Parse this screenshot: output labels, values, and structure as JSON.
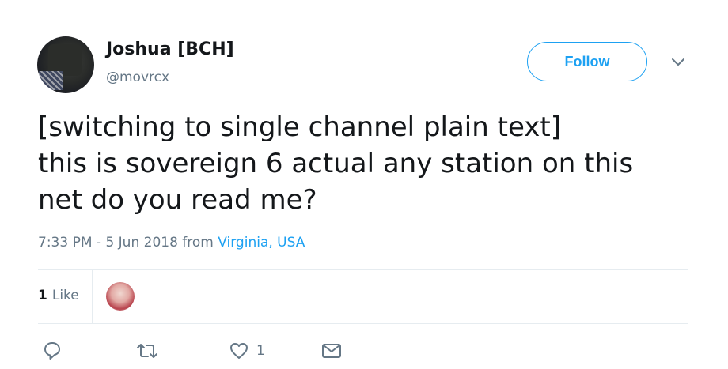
{
  "user": {
    "display_name": "Joshua [BCH]",
    "handle": "@movrcx"
  },
  "header": {
    "follow_label": "Follow"
  },
  "tweet": {
    "lines": [
      "[switching to single channel plain text]",
      "this is sovereign 6 actual any station on this",
      "net do you read me?"
    ],
    "timestamp": "7:33 PM - 5 Jun 2018",
    "from_label": "from",
    "location": "Virginia, USA"
  },
  "stats": {
    "like_count": "1",
    "like_label": "Like"
  },
  "actions": {
    "like_count": "1",
    "icons": [
      "reply-icon",
      "retweet-icon",
      "heart-icon",
      "direct-message-icon"
    ]
  },
  "colors": {
    "accent": "#1da1f2",
    "text": "#14171a",
    "secondary": "#657786",
    "divider": "#e6ecf0"
  }
}
